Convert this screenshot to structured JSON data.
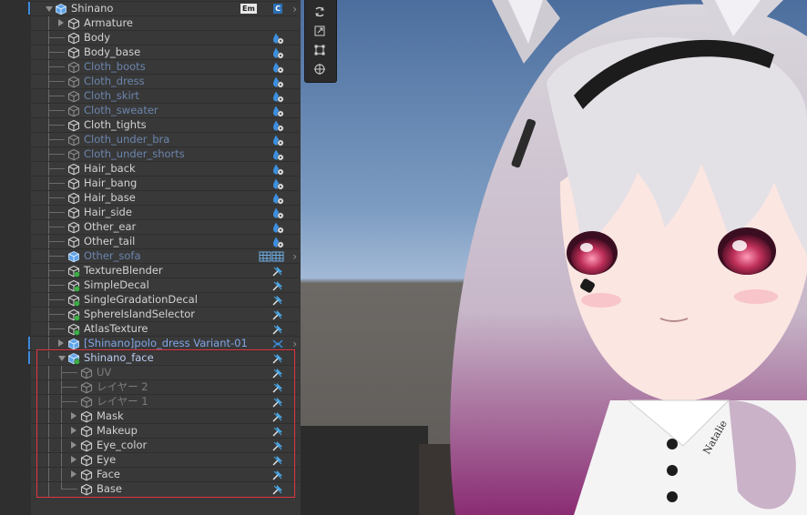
{
  "hierarchy": {
    "items": [
      {
        "label": "Shinano",
        "depth": 0,
        "arrow": "down",
        "icon": "prefab",
        "style": "normal",
        "badges": [
          "em",
          "c"
        ],
        "chevron": true
      },
      {
        "label": "Armature",
        "depth": 1,
        "arrow": "right",
        "icon": "cube",
        "style": "normal"
      },
      {
        "label": "Body",
        "depth": 1,
        "icon": "cube",
        "style": "normal",
        "right_icon": "drop"
      },
      {
        "label": "Body_base",
        "depth": 1,
        "icon": "cube",
        "style": "normal",
        "right_icon": "drop"
      },
      {
        "label": "Cloth_boots",
        "depth": 1,
        "icon": "cube",
        "style": "dim",
        "right_icon": "drop"
      },
      {
        "label": "Cloth_dress",
        "depth": 1,
        "icon": "cube",
        "style": "dim",
        "right_icon": "drop"
      },
      {
        "label": "Cloth_skirt",
        "depth": 1,
        "icon": "cube",
        "style": "dim",
        "right_icon": "drop"
      },
      {
        "label": "Cloth_sweater",
        "depth": 1,
        "icon": "cube",
        "style": "dim",
        "right_icon": "drop"
      },
      {
        "label": "Cloth_tights",
        "depth": 1,
        "icon": "cube",
        "style": "normal",
        "right_icon": "drop"
      },
      {
        "label": "Cloth_under_bra",
        "depth": 1,
        "icon": "cube",
        "style": "dim",
        "right_icon": "drop"
      },
      {
        "label": "Cloth_under_shorts",
        "depth": 1,
        "icon": "cube",
        "style": "dim",
        "right_icon": "drop"
      },
      {
        "label": "Hair_back",
        "depth": 1,
        "icon": "cube",
        "style": "normal",
        "right_icon": "drop"
      },
      {
        "label": "Hair_bang",
        "depth": 1,
        "icon": "cube",
        "style": "normal",
        "right_icon": "drop"
      },
      {
        "label": "Hair_base",
        "depth": 1,
        "icon": "cube",
        "style": "normal",
        "right_icon": "drop"
      },
      {
        "label": "Hair_side",
        "depth": 1,
        "icon": "cube",
        "style": "normal",
        "right_icon": "drop"
      },
      {
        "label": "Other_ear",
        "depth": 1,
        "icon": "cube",
        "style": "normal",
        "right_icon": "drop"
      },
      {
        "label": "Other_tail",
        "depth": 1,
        "icon": "cube",
        "style": "normal",
        "right_icon": "drop"
      },
      {
        "label": "Other_sofa",
        "depth": 1,
        "icon": "prefab",
        "style": "dim",
        "right_icon": "grid",
        "chevron": true
      },
      {
        "label": "TextureBlender",
        "depth": 1,
        "icon": "cube-green",
        "style": "normal",
        "right_icon": "pin"
      },
      {
        "label": "SimpleDecal",
        "depth": 1,
        "icon": "cube-green",
        "style": "normal",
        "right_icon": "pin"
      },
      {
        "label": "SingleGradationDecal",
        "depth": 1,
        "icon": "cube-green",
        "style": "normal",
        "right_icon": "pin"
      },
      {
        "label": "SphereIslandSelector",
        "depth": 1,
        "icon": "cube-green",
        "style": "normal",
        "right_icon": "pin"
      },
      {
        "label": "AtlasTexture",
        "depth": 1,
        "icon": "cube-green",
        "style": "normal",
        "right_icon": "pin"
      },
      {
        "label": "[Shinano]polo_dress Variant-01",
        "depth": 1,
        "arrow": "right",
        "icon": "prefab",
        "style": "prefab",
        "right_icon": "link",
        "chevron": true
      },
      {
        "label": "Shinano_face",
        "depth": 1,
        "arrow": "down",
        "icon": "prefab-green",
        "style": "active-face",
        "right_icon": "pin"
      },
      {
        "label": "UV",
        "depth": 2,
        "icon": "cube",
        "style": "sub-dim",
        "right_icon": "pin"
      },
      {
        "label": "レイヤー 2",
        "depth": 2,
        "icon": "cube",
        "style": "sub-dim",
        "right_icon": "pin"
      },
      {
        "label": "レイヤー 1",
        "depth": 2,
        "icon": "cube",
        "style": "sub-dim",
        "right_icon": "pin"
      },
      {
        "label": "Mask",
        "depth": 2,
        "arrow": "right",
        "icon": "cube",
        "style": "normal",
        "right_icon": "pin"
      },
      {
        "label": "Makeup",
        "depth": 2,
        "arrow": "right",
        "icon": "cube",
        "style": "normal",
        "right_icon": "pin"
      },
      {
        "label": "Eye_color",
        "depth": 2,
        "arrow": "right",
        "icon": "cube",
        "style": "normal",
        "right_icon": "pin"
      },
      {
        "label": "Eye",
        "depth": 2,
        "arrow": "right",
        "icon": "cube",
        "style": "normal",
        "right_icon": "pin"
      },
      {
        "label": "Face",
        "depth": 2,
        "arrow": "right",
        "icon": "cube",
        "style": "normal",
        "right_icon": "pin"
      },
      {
        "label": "Base",
        "depth": 2,
        "icon": "cube",
        "style": "normal",
        "right_icon": "pin"
      }
    ],
    "badges": {
      "em": "Em",
      "c": "C"
    }
  },
  "scene": {
    "tools": [
      "rotate-tool-icon",
      "scale-tool-icon",
      "rect-tool-icon",
      "transform-tool-icon"
    ],
    "necklace_text": "Natalie"
  },
  "colors": {
    "panel_bg": "#383838",
    "selection_outline": "#e2353f",
    "accent_blue": "#3d8ae0",
    "hair": "#d9d6dc",
    "eye": "#c0305a"
  }
}
